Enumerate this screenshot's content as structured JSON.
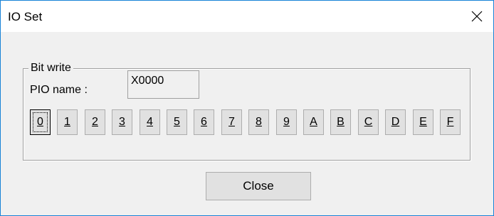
{
  "window": {
    "title": "IO Set",
    "close_icon": "close-icon"
  },
  "group": {
    "legend": "Bit write",
    "pio_label": "PIO name :",
    "pio_value": "X0000",
    "bits": [
      "0",
      "1",
      "2",
      "3",
      "4",
      "5",
      "6",
      "7",
      "8",
      "9",
      "A",
      "B",
      "C",
      "D",
      "E",
      "F"
    ],
    "focused_bit": "0"
  },
  "footer": {
    "close_label": "Close"
  },
  "colors": {
    "window_border": "#1883d7",
    "face": "#f0f0f0",
    "button_face": "#e1e1e1"
  }
}
